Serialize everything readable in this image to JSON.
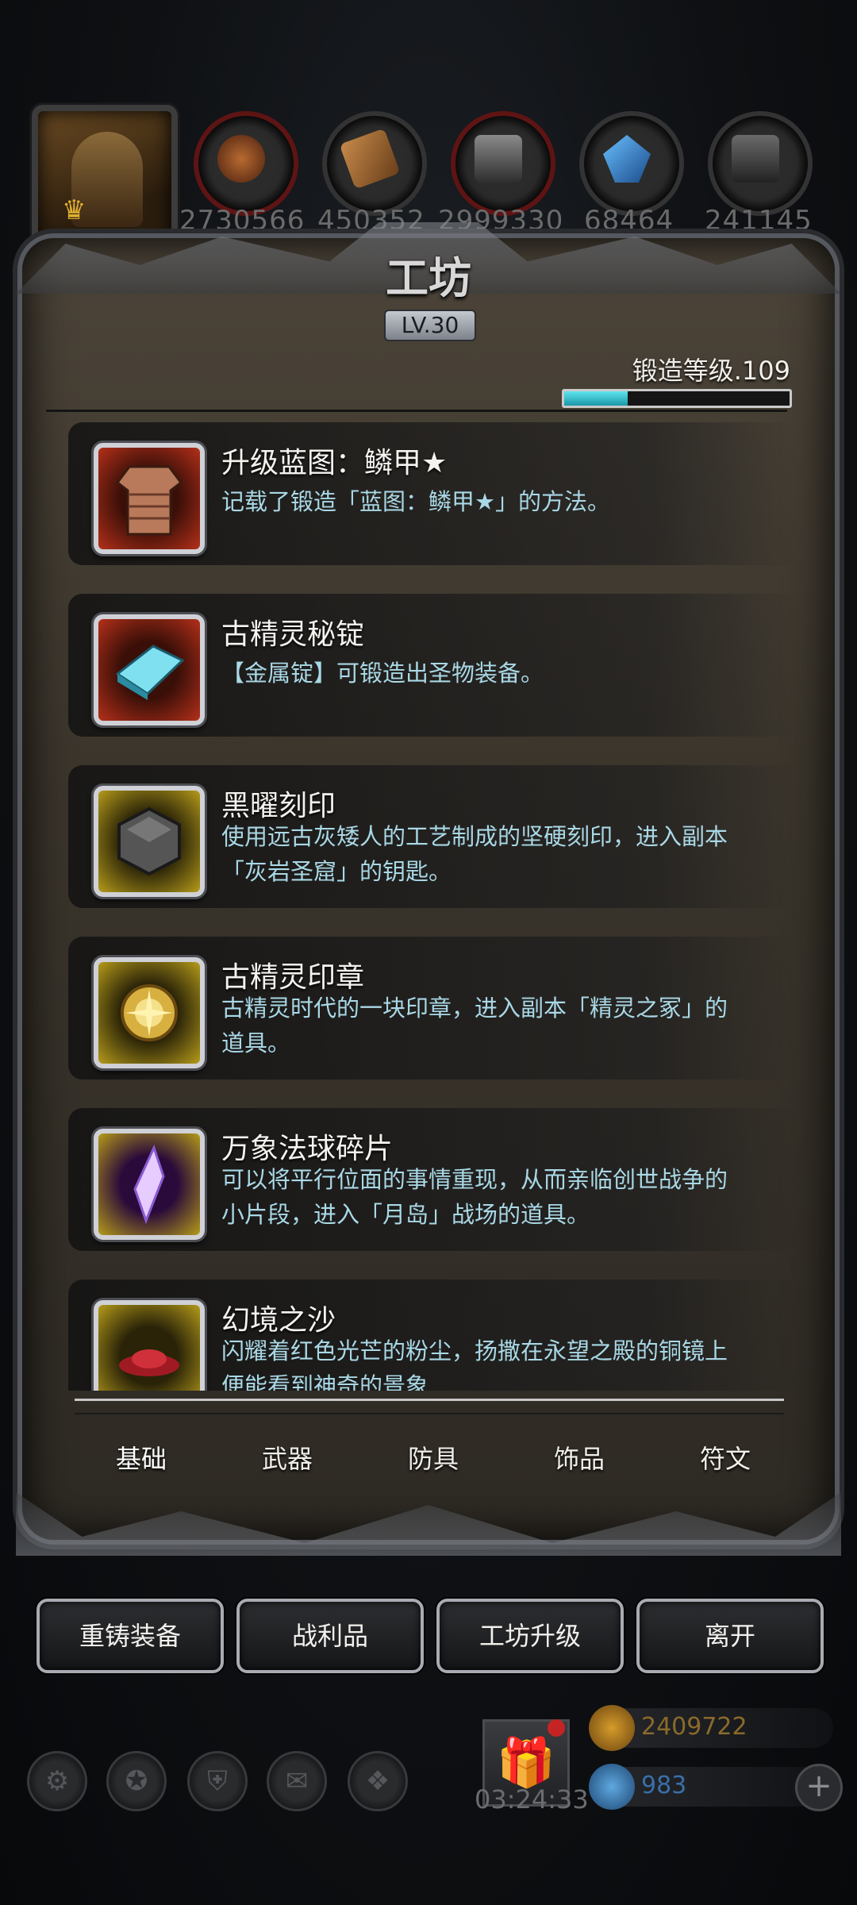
{
  "header": {
    "resources": [
      {
        "icon": "ore-icon",
        "value": "2730566"
      },
      {
        "icon": "wood-icon",
        "value": "450352"
      },
      {
        "icon": "iron-icon",
        "value": "2999330"
      },
      {
        "icon": "crystal-icon",
        "value": "68464"
      },
      {
        "icon": "steel-icon",
        "value": "241145"
      }
    ]
  },
  "panel": {
    "title": "工坊",
    "level": "LV.30",
    "forge_level": "锻造等级.109",
    "forge_progress": 0.28
  },
  "items": [
    {
      "name": "升级蓝图：鳞甲★",
      "desc": "记载了锻造「蓝图：鳞甲★」的方法。",
      "icon": "scale-armor-icon",
      "frame": "red"
    },
    {
      "name": "古精灵秘锭",
      "desc": "【金属锭】可锻造出圣物装备。",
      "icon": "crystal-ingot-icon",
      "frame": "red"
    },
    {
      "name": "黑曜刻印",
      "desc": "使用远古灰矮人的工艺制成的坚硬刻印，进入副本「灰岩圣窟」的钥匙。",
      "icon": "obsidian-seal-icon",
      "frame": "gold"
    },
    {
      "name": "古精灵印章",
      "desc": "古精灵时代的一块印章，进入副本「精灵之冢」的道具。",
      "icon": "elf-seal-icon",
      "frame": "gold"
    },
    {
      "name": "万象法球碎片",
      "desc": "可以将平行位面的事情重现，从而亲临创世战争的小片段，进入「月岛」战场的道具。",
      "icon": "orb-shard-icon",
      "frame": "gold"
    },
    {
      "name": "幻境之沙",
      "desc": "闪耀着红色光芒的粉尘，扬撒在永望之殿的铜镜上便能看到神奇的景象",
      "icon": "illusion-sand-icon",
      "frame": "gold"
    }
  ],
  "tabs": [
    "基础",
    "武器",
    "防具",
    "饰品",
    "符文"
  ],
  "active_tab": 0,
  "actions": [
    "重铸装备",
    "战利品",
    "工坊升级",
    "离开"
  ],
  "footer": {
    "timer": "03:24:33",
    "gold": "2409722",
    "gems": "983"
  },
  "colors": {
    "desc_text": "#a9d8e6",
    "progress": "#3cc6d4",
    "gold_text": "#8a6a2a",
    "gem_text": "#3a6ea8"
  }
}
